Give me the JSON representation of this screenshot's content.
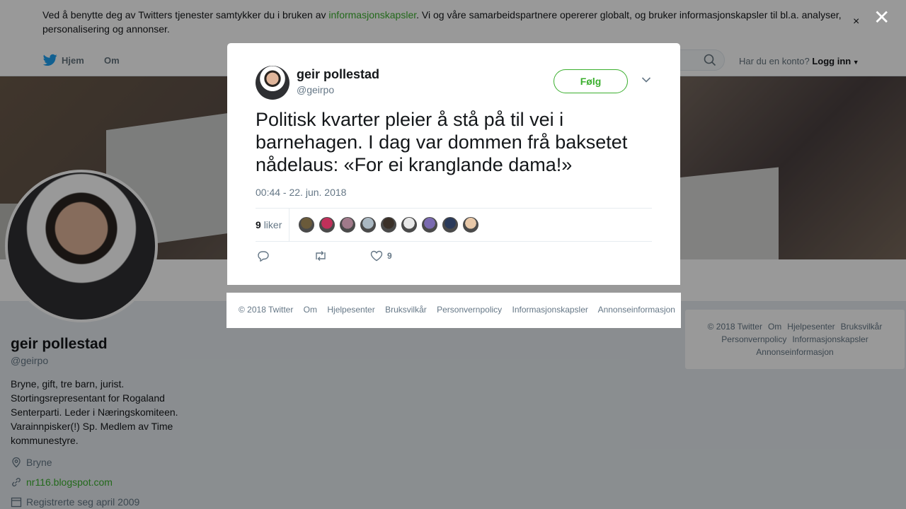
{
  "cookie": {
    "text_before": "Ved å benytte deg av Twitters tjenester samtykker du i bruken av ",
    "link": "informasjonskapsler",
    "text_after": ". Vi og våre samarbeidspartnere opererer globalt, og bruker informasjonskapsler til bl.a. analyser, personalisering og annonser.",
    "close": "×"
  },
  "nav": {
    "home": "Hjem",
    "about": "Om",
    "account_question": "Har du en konto?",
    "login": "Logg inn"
  },
  "profile": {
    "name": "geir pollestad",
    "handle": "@geirpo",
    "bio": "Bryne, gift, tre barn, jurist. Stortingsrepresentant for Rogaland Senterparti. Leder i Næringskomiteen. Varainnpisker(!) Sp. Medlem av Time kommunestyre.",
    "location": "Bryne",
    "website": "nr116.blogspot.com",
    "joined": "Registrerte seg april 2009"
  },
  "side_footer": {
    "line1": [
      "© 2018 Twitter",
      "Om",
      "Hjelpesenter",
      "Bruksvilkår"
    ],
    "line2": [
      "Personvernpolicy",
      "Informasjonskapsler"
    ],
    "line3": [
      "Annonseinformasjon"
    ]
  },
  "overlay": {
    "close": "✕"
  },
  "tweet": {
    "name": "geir pollestad",
    "handle": "@geirpo",
    "follow": "Følg",
    "text": "Politisk kvarter pleier å stå på til vei i barnehagen. I dag var dommen frå baksetet nådelaus: «For ei kranglande dama!»",
    "time": "00:44 - 22. jun. 2018",
    "likes_count": "9",
    "likes_label": "liker",
    "like_action_count": "9",
    "liker_colors": [
      "#6a5a3a",
      "#c0305a",
      "#a07a8a",
      "#aab8c2",
      "#3a3028",
      "#e8e8e8",
      "#7a6ab0",
      "#2a3a5a",
      "#e8c8a8"
    ]
  },
  "modal_footer": {
    "items": [
      "© 2018 Twitter",
      "Om",
      "Hjelpesenter",
      "Bruksvilkår",
      "Personvernpolicy",
      "Informasjonskapsler",
      "Annonseinformasjon"
    ]
  },
  "colors": {
    "accent": "#3baf2e",
    "twitter_blue": "#1da1f2",
    "muted": "#657786"
  }
}
